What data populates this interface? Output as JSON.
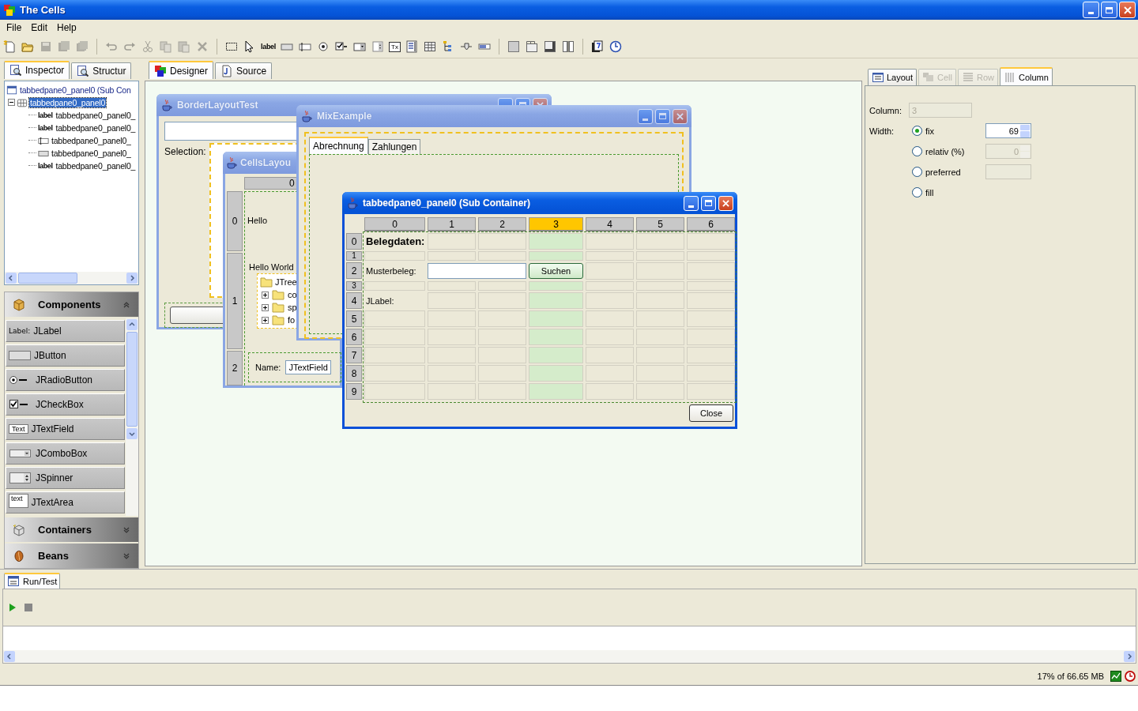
{
  "window": {
    "title": "The Cells"
  },
  "menu": [
    "File",
    "Edit",
    "Help"
  ],
  "toolbar": [
    {
      "kind": "new",
      "disabled": false
    },
    {
      "kind": "open",
      "disabled": false
    },
    {
      "kind": "save",
      "disabled": true
    },
    {
      "kind": "save-as",
      "disabled": true
    },
    {
      "kind": "save-all",
      "disabled": true
    },
    {
      "kind": "separator"
    },
    {
      "kind": "undo",
      "disabled": true
    },
    {
      "kind": "redo",
      "disabled": true
    },
    {
      "kind": "cut",
      "disabled": true
    },
    {
      "kind": "copy",
      "disabled": true
    },
    {
      "kind": "paste",
      "disabled": true
    },
    {
      "kind": "delete",
      "disabled": true
    },
    {
      "kind": "separator"
    },
    {
      "kind": "select",
      "disabled": false
    },
    {
      "kind": "pointer",
      "disabled": false
    },
    {
      "kind": "text",
      "text": "label",
      "disabled": false
    },
    {
      "kind": "button",
      "disabled": false
    },
    {
      "kind": "textfield",
      "disabled": false
    },
    {
      "kind": "radio",
      "disabled": false
    },
    {
      "kind": "checkbox",
      "disabled": false
    },
    {
      "kind": "combo",
      "disabled": false
    },
    {
      "kind": "spinner",
      "disabled": false
    },
    {
      "kind": "boxed-text",
      "text": "Tx",
      "disabled": false
    },
    {
      "kind": "list",
      "disabled": false
    },
    {
      "kind": "table",
      "disabled": false
    },
    {
      "kind": "tree",
      "disabled": false
    },
    {
      "kind": "slider",
      "disabled": false
    },
    {
      "kind": "progress",
      "disabled": false
    },
    {
      "kind": "separator"
    },
    {
      "kind": "panel",
      "disabled": false
    },
    {
      "kind": "tabbed",
      "disabled": false
    },
    {
      "kind": "scroll",
      "disabled": false
    },
    {
      "kind": "split",
      "disabled": false
    },
    {
      "kind": "separator"
    },
    {
      "kind": "page",
      "disabled": false
    },
    {
      "kind": "clock",
      "disabled": false
    }
  ],
  "left_tabs": [
    {
      "label": "Inspector",
      "selected": true
    },
    {
      "label": "Structur",
      "selected": false
    }
  ],
  "inspector_tree": [
    {
      "label": "tabbedpane0_panel0 (Sub Con",
      "kind": "container",
      "selected": false,
      "children": [
        {
          "label": "tabbedpane0_panel0",
          "kind": "panel",
          "selected": true,
          "expanded": true,
          "children": [
            {
              "label": "tabbedpane0_panel0_",
              "kind": "label",
              "icon_text": "label",
              "selected": false
            },
            {
              "label": "tabbedpane0_panel0_",
              "kind": "label",
              "icon_text": "label",
              "selected": false
            },
            {
              "label": "tabbedpane0_panel0_",
              "kind": "textfield",
              "selected": false
            },
            {
              "label": "tabbedpane0_panel0_",
              "kind": "button",
              "selected": false
            },
            {
              "label": "tabbedpane0_panel0_",
              "kind": "label",
              "icon_text": "label",
              "selected": false
            }
          ]
        }
      ]
    }
  ],
  "palette": {
    "sections": [
      {
        "title": "Components",
        "kind": "components",
        "expanded": true,
        "items": [
          {
            "kind": "label",
            "icon_text": "Label:",
            "label": "JLabel"
          },
          {
            "kind": "button",
            "label": "JButton"
          },
          {
            "kind": "radio",
            "label": "JRadioButton"
          },
          {
            "kind": "checkbox",
            "label": "JCheckBox"
          },
          {
            "kind": "textfield",
            "icon_text": "Text",
            "label": "JTextField"
          },
          {
            "kind": "combo",
            "label": "JComboBox"
          },
          {
            "kind": "spinner",
            "label": "JSpinner"
          },
          {
            "kind": "textarea",
            "icon_text": "text",
            "label": "JTextArea"
          }
        ]
      },
      {
        "title": "Containers",
        "kind": "containers",
        "expanded": false
      },
      {
        "title": "Beans",
        "kind": "beans",
        "expanded": false
      }
    ]
  },
  "designer": {
    "tabs": [
      {
        "label": "Designer",
        "kind": "designer",
        "selected": true
      },
      {
        "label": "Source",
        "kind": "source",
        "selected": false
      }
    ],
    "windows": [
      {
        "kind": "border",
        "title": "BorderLayoutTest",
        "active": false,
        "label": "Selection:"
      },
      {
        "kind": "cells",
        "title": "CellsLayou",
        "active": false,
        "column_header": "0",
        "rows": [
          {
            "label": "0",
            "text": "Hello"
          },
          {
            "label": "1",
            "text": "Hello World"
          },
          {
            "label": "2"
          }
        ],
        "tree": {
          "root": "JTree",
          "children": [
            {
              "label": "co",
              "expanded": false
            },
            {
              "label": "sp",
              "expanded": false
            },
            {
              "label": "fo",
              "expanded": false
            }
          ]
        },
        "name_label": "Name:",
        "name_field": "JTextField"
      },
      {
        "kind": "tabs",
        "title": "MixExample",
        "active": false,
        "tabs": [
          {
            "label": "Abrechnung",
            "selected": true
          },
          {
            "label": "Zahlungen",
            "selected": false
          }
        ]
      },
      {
        "kind": "grid",
        "title": "tabbedpane0_panel0 (Sub Container)",
        "active": true,
        "columns": [
          {
            "label": "0",
            "selected": false
          },
          {
            "label": "1",
            "selected": false
          },
          {
            "label": "2",
            "selected": false
          },
          {
            "label": "3",
            "selected": true
          },
          {
            "label": "4",
            "selected": false
          },
          {
            "label": "5",
            "selected": false
          },
          {
            "label": "6",
            "selected": false
          }
        ],
        "rows": [
          {
            "label": "0",
            "compact": false,
            "cells": [
              {
                "kind": "heading",
                "text": "Belegdaten:"
              }
            ]
          },
          {
            "label": "1",
            "compact": true
          },
          {
            "label": "2",
            "compact": false,
            "cells": [
              {
                "kind": "label",
                "text": "Musterbeleg:"
              },
              {
                "kind": "field"
              },
              {
                "kind": "button",
                "text": "Suchen"
              }
            ]
          },
          {
            "label": "3",
            "compact": true
          },
          {
            "label": "4",
            "compact": false,
            "cells": [
              {
                "kind": "label",
                "text": "JLabel:"
              }
            ]
          },
          {
            "label": "5",
            "compact": false
          },
          {
            "label": "6",
            "compact": false
          },
          {
            "label": "7",
            "compact": false
          },
          {
            "label": "8",
            "compact": false
          },
          {
            "label": "9",
            "compact": false
          }
        ],
        "close": "Close"
      }
    ]
  },
  "properties": {
    "tabs": [
      {
        "label": "Layout",
        "kind": "layout",
        "selected": false,
        "disabled": false
      },
      {
        "label": "Cell",
        "kind": "cell",
        "selected": false,
        "disabled": true
      },
      {
        "label": "Row",
        "kind": "row",
        "selected": false,
        "disabled": true
      },
      {
        "label": "Column",
        "kind": "column",
        "selected": true,
        "disabled": false
      }
    ],
    "column_label": "Column:",
    "column_value": "3",
    "width_label": "Width:",
    "width_options": [
      {
        "label": "fix",
        "selected": true,
        "input": {
          "kind": "spinner",
          "value": "69",
          "disabled": false
        }
      },
      {
        "label": "relativ (%)",
        "selected": false,
        "input": {
          "kind": "spinner",
          "value": "0",
          "disabled": true
        }
      },
      {
        "label": "preferred",
        "selected": false,
        "input": {
          "kind": "field",
          "disabled": true
        }
      },
      {
        "label": "fill",
        "selected": false
      }
    ]
  },
  "run_panel": {
    "tab": "Run/Test"
  },
  "status_bar": {
    "memory": "17% of 66.65 MB"
  }
}
